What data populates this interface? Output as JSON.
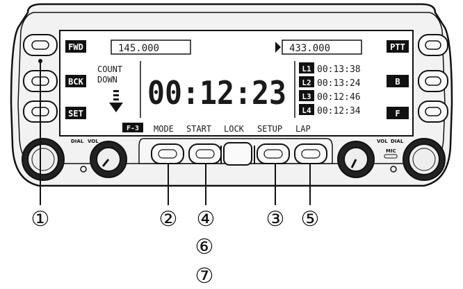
{
  "side_keys": {
    "left": [
      "FWD",
      "BCK",
      "SET"
    ],
    "right": [
      "PTT",
      "B",
      "F"
    ]
  },
  "lcd": {
    "freq_left": "145.000",
    "freq_right": "433.000",
    "mode_label": "COUNT",
    "mode_label2": "DOWN",
    "timer": "00:12:23",
    "laps": [
      {
        "tag": "L1",
        "time": "00:13:38"
      },
      {
        "tag": "L2",
        "time": "00:13:24"
      },
      {
        "tag": "L3",
        "time": "00:12:46"
      },
      {
        "tag": "L4",
        "time": "00:12:34"
      }
    ],
    "page_badge": "F-3",
    "softkeys": [
      "MODE",
      "START",
      "LOCK",
      "SETUP",
      "LAP"
    ]
  },
  "knob_labels": {
    "left_outer": "DIAL",
    "left_inner": "VOL",
    "right_inner": "VOL",
    "right_outer": "DIAL",
    "mic": "MIC"
  },
  "callouts": [
    "①",
    "②",
    "③",
    "④",
    "⑤",
    "⑥",
    "⑦"
  ]
}
